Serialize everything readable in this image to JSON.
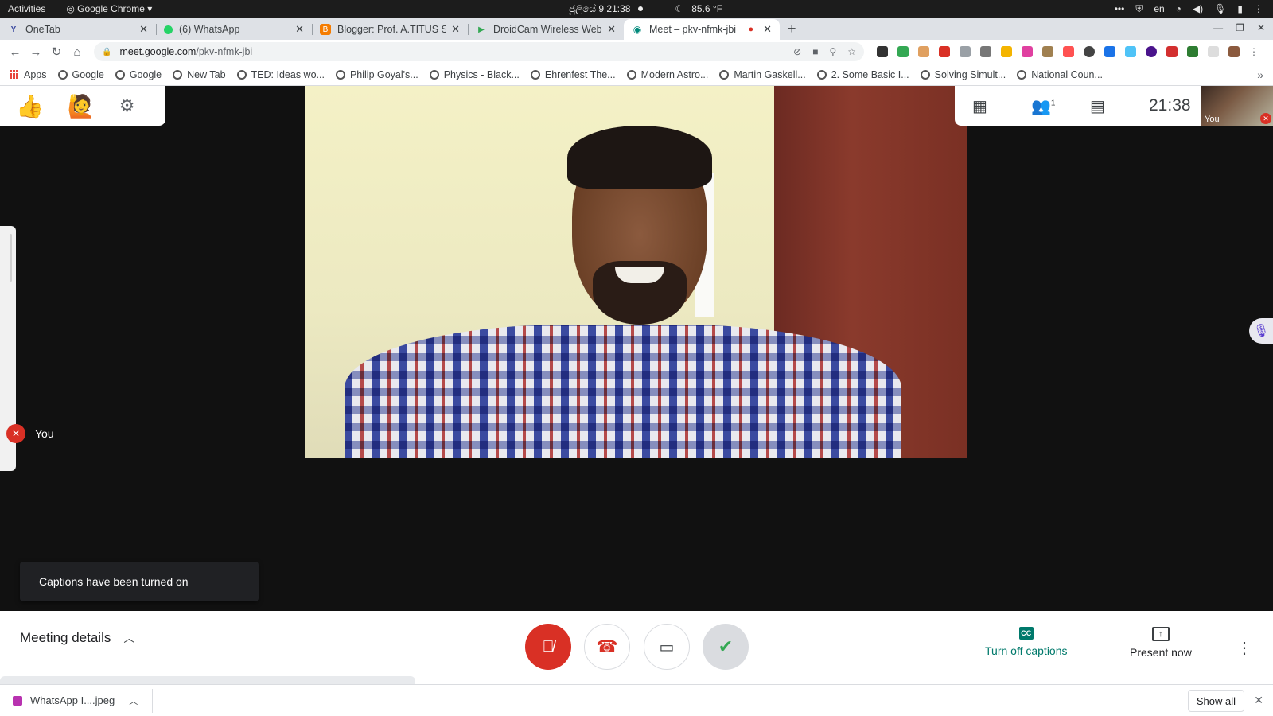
{
  "os_bar": {
    "activities": "Activities",
    "app_name": "Google Chrome",
    "date_time": "ජූලියේ 9  21:38",
    "temperature": "85.6 °F",
    "language": "en"
  },
  "tabs": [
    {
      "title": "OneTab",
      "favicon_color": "#3b4aa0"
    },
    {
      "title": "(6) WhatsApp",
      "favicon_color": "#25d366"
    },
    {
      "title": "Blogger: Prof. A.TITUS SA",
      "favicon_color": "#f57c00"
    },
    {
      "title": "DroidCam Wireless Webc",
      "favicon_color": "#34a853"
    },
    {
      "title": "Meet – pkv-nfmk-jbi",
      "favicon_color": "#00897b",
      "active": true
    }
  ],
  "omnibox": {
    "host": "meet.google.com",
    "path": "/pkv-nfmk-jbi"
  },
  "bookmarks": [
    "Apps",
    "Google",
    "Google",
    "New Tab",
    "TED: Ideas wo...",
    "Philip Goyal's...",
    "Physics - Black...",
    "Ehrenfest The...",
    "Modern Astro...",
    "Martin Gaskell...",
    "2. Some Basic I...",
    "Solving Simult...",
    "National Coun..."
  ],
  "meet": {
    "clock": "21:38",
    "participant_count": "1",
    "self_label": "You",
    "tile_label": "You",
    "toast": "Captions have been turned on",
    "meeting_details": "Meeting details",
    "captions_label": "Turn off captions",
    "captions_icon": "CC",
    "present_label": "Present now"
  },
  "downloads": {
    "file": "WhatsApp I....jpeg",
    "show_all": "Show all"
  },
  "colors": {
    "mute_red": "#d93025",
    "captions_teal": "#00796b",
    "stage_bg": "#111111"
  }
}
